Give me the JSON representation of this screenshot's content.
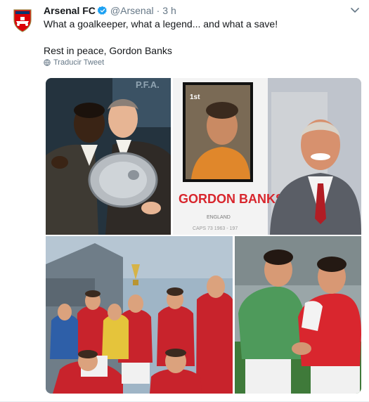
{
  "tweet": {
    "display_name": "Arsenal FC",
    "handle": "@Arsenal",
    "separator": "·",
    "time": "3 h",
    "line1": "What a goalkeeper, what a legend... and what a save!",
    "line2": "Rest in peace, Gordon Banks",
    "translate_label": "Traducir Tweet"
  },
  "media": {
    "stamp_name": "GORDON BANKS",
    "stamp_country": "ENGLAND",
    "stamp_value": "1st",
    "stamp_caps": "CAPS 73 1963 - 197"
  },
  "colors": {
    "verified": "#1da1f2",
    "arsenal_red": "#db0007",
    "secondary_text": "#657786"
  }
}
